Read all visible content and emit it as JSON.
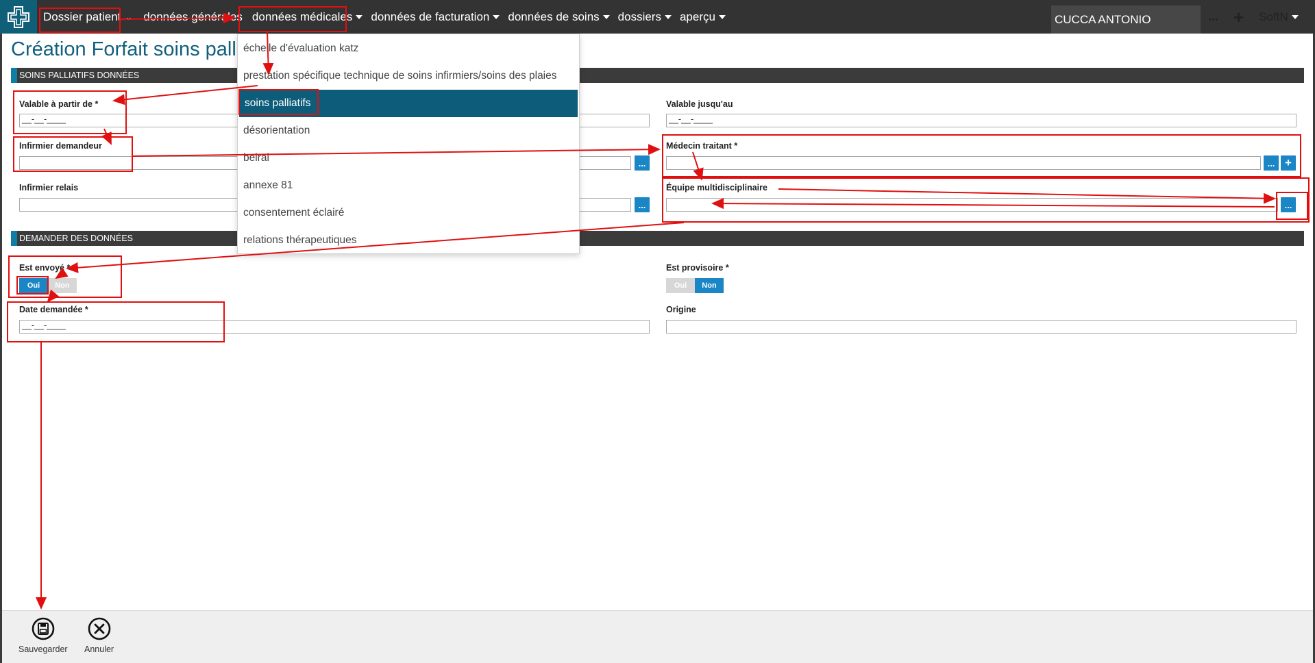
{
  "navbar": {
    "items": [
      {
        "label": "Dossier patient"
      },
      {
        "label": "données générales"
      },
      {
        "label": "données médicales"
      },
      {
        "label": "données de facturation"
      },
      {
        "label": "données de soins"
      },
      {
        "label": "dossiers"
      },
      {
        "label": "aperçu"
      }
    ],
    "patient_name": "CUCCA ANTONIO",
    "more": "...",
    "add": "+",
    "user": "SoftN"
  },
  "page": {
    "title": "Création Forfait soins palliatifs"
  },
  "dropdown": {
    "items": [
      {
        "label": "échelle d'évaluation katz"
      },
      {
        "label": "prestation spécifique technique de soins infirmiers/soins des plaies"
      },
      {
        "label": "soins palliatifs",
        "active": true
      },
      {
        "label": "désorientation"
      },
      {
        "label": "belrai"
      },
      {
        "label": "annexe 81"
      },
      {
        "label": "consentement éclairé"
      },
      {
        "label": "relations thérapeutiques"
      }
    ]
  },
  "section1": {
    "title": "SOINS PALLIATIFS DONNÉES",
    "valid_from_label": "Valable à partir de *",
    "valid_from_value": "__-__-____",
    "valid_until_label": "Valable jusqu'au",
    "valid_until_value": "__-__-____",
    "requesting_nurse_label": "Infirmier demandeur",
    "treating_doctor_label": "Médecin traitant *",
    "relay_nurse_label": "Infirmier relais",
    "team_label": "Équipe multidisciplinaire",
    "lookup_btn": "...",
    "add_btn": "+"
  },
  "section2": {
    "title": "DEMANDER DES DONNÉES",
    "sent_label": "Est envoyé *",
    "provisional_label": "Est provisoire *",
    "yes": "Oui",
    "no": "Non",
    "date_label": "Date demandée *",
    "date_value": "__-__-____",
    "origin_label": "Origine"
  },
  "footer": {
    "save": "Sauvegarder",
    "cancel": "Annuler"
  },
  "colors": {
    "navbar": "#333333",
    "accent": "#1a86c5",
    "title": "#11607d",
    "annotation": "#e01010"
  }
}
